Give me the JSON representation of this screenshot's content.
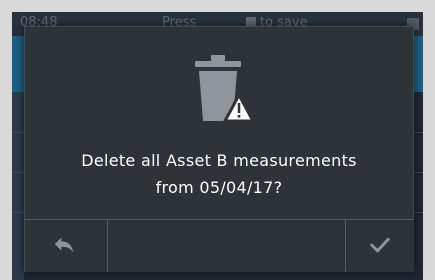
{
  "status_bar": {
    "time": "08:48",
    "hint_prefix": "Press",
    "hint_suffix": "to save"
  },
  "dialog": {
    "icon": "trash-warning-icon",
    "message_line1": "Delete all Asset B measurements",
    "message_line2": "from 05/04/17?"
  },
  "buttons": {
    "back_icon": "back-arrow-icon",
    "confirm_icon": "checkmark-icon"
  },
  "colors": {
    "dialog_bg": "#2e3338",
    "text": "#ffffff",
    "icon_gray": "#8e959b",
    "accent_blue": "#1c5f84"
  }
}
